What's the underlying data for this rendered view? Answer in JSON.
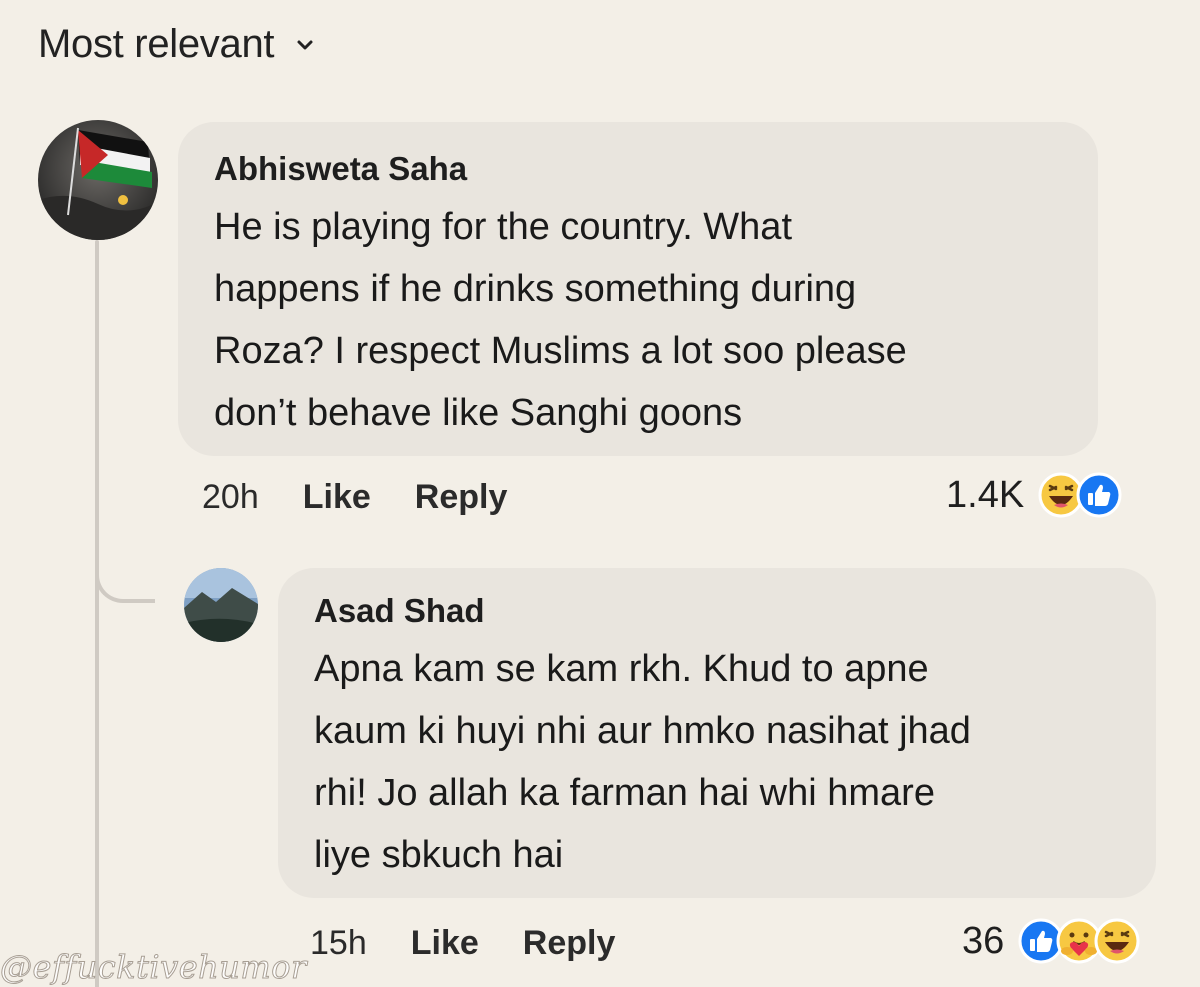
{
  "sort": {
    "label": "Most relevant",
    "icon": "chevron-down-icon"
  },
  "comments": [
    {
      "author": "Abhisweta Saha",
      "text": "He is playing for the country. What\nhappens if he drinks something during\nRoza? I respect Muslims a lot soo please\ndon’t behave like Sanghi goons",
      "time": "20h",
      "like_label": "Like",
      "reply_label": "Reply",
      "reaction_count": "1.4K",
      "reactions": [
        "haha-emoji-icon",
        "like-thumb-icon"
      ]
    },
    {
      "author": "Asad Shad",
      "text": "Apna kam se kam rkh. Khud to apne\nkaum ki huyi nhi aur hmko nasihat jhad\nrhi! Jo allah ka farman hai whi hmare\nliye sbkuch hai",
      "time": "15h",
      "like_label": "Like",
      "reply_label": "Reply",
      "reaction_count": "36",
      "reactions": [
        "like-thumb-icon",
        "care-hug-emoji-icon",
        "haha-emoji-icon"
      ]
    }
  ],
  "watermark": "@effucktivehumor",
  "colors": {
    "background": "#f3efe7",
    "bubble": "#e9e5de",
    "like_blue": "#1877f2",
    "haha_yellow": "#f7c842"
  }
}
